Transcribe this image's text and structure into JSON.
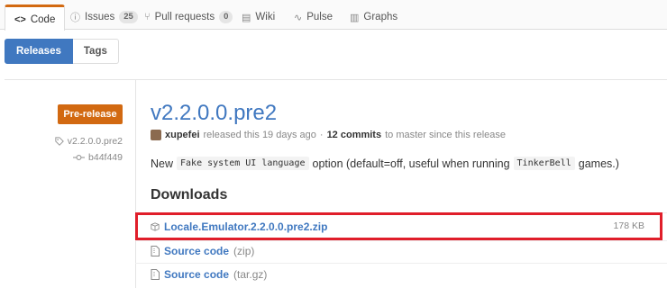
{
  "tabs": [
    {
      "label": "Code",
      "icon": "code-icon",
      "glyph": "<>",
      "active": true
    },
    {
      "label": "Issues",
      "icon": "issue-icon",
      "glyph": "ⓘ",
      "count": "25"
    },
    {
      "label": "Pull requests",
      "icon": "pull-request-icon",
      "glyph": "⑂",
      "count": "0"
    },
    {
      "label": "Wiki",
      "icon": "wiki-icon",
      "glyph": "▤"
    },
    {
      "label": "Pulse",
      "icon": "pulse-icon",
      "glyph": "∿"
    },
    {
      "label": "Graphs",
      "icon": "graph-icon",
      "glyph": "▥"
    }
  ],
  "subnav": {
    "releases": "Releases",
    "tags": "Tags"
  },
  "release": {
    "badge": "Pre-release",
    "tag": "v2.2.0.0.pre2",
    "commit": "b44f449",
    "title": "v2.2.0.0.pre2",
    "author": "xupefei",
    "released_text": "released this 19 days ago",
    "separator": "·",
    "commits": "12 commits",
    "commits_suffix": "to master since this release",
    "description": {
      "before": "New",
      "code1": "Fake system UI language",
      "middle": "option (default=off, useful when running",
      "code2": "TinkerBell",
      "after": "games.)"
    }
  },
  "downloads": {
    "heading": "Downloads",
    "files": [
      {
        "name": "Locale.Emulator.2.2.0.0.pre2.zip",
        "size": "178 KB",
        "icon": "package-icon"
      },
      {
        "name": "Source code",
        "kind": "(zip)",
        "icon": "file-zip-icon"
      },
      {
        "name": "Source code",
        "kind": "(tar.gz)",
        "icon": "file-zip-icon"
      }
    ]
  },
  "colors": {
    "accent": "#4078c0",
    "prerelease": "#d26911",
    "highlight": "#e01e2a",
    "active_tab": "#d26911"
  }
}
